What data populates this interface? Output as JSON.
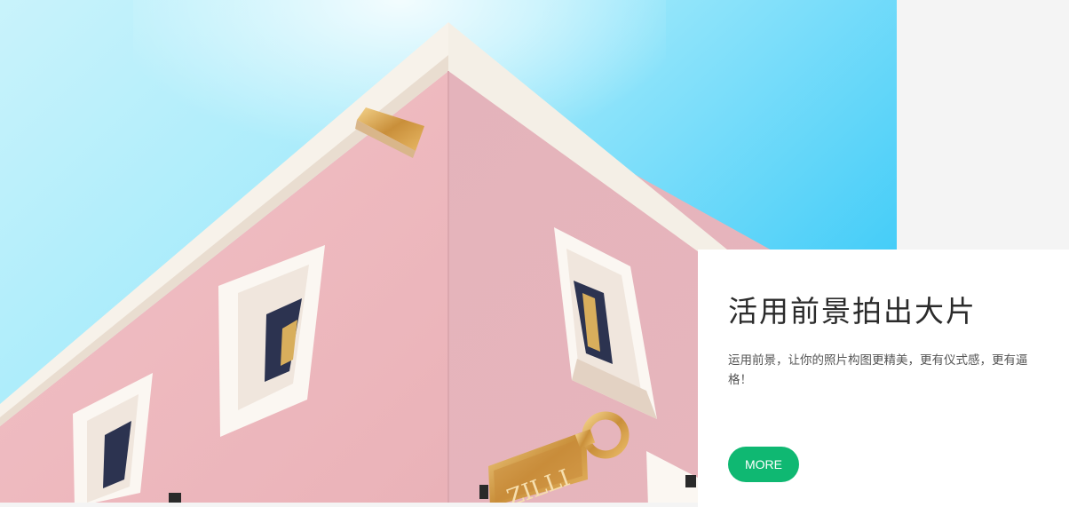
{
  "card": {
    "title": "活用前景拍出大片",
    "description": "运用前景，让你的照片构图更精美，更有仪式感，更有逼格！",
    "button_label": "MORE"
  },
  "hero": {
    "sign_text": "ZILLI"
  },
  "colors": {
    "accent": "#0fb872",
    "sky": "#8fe2f8",
    "wall": "#eab6bd"
  }
}
